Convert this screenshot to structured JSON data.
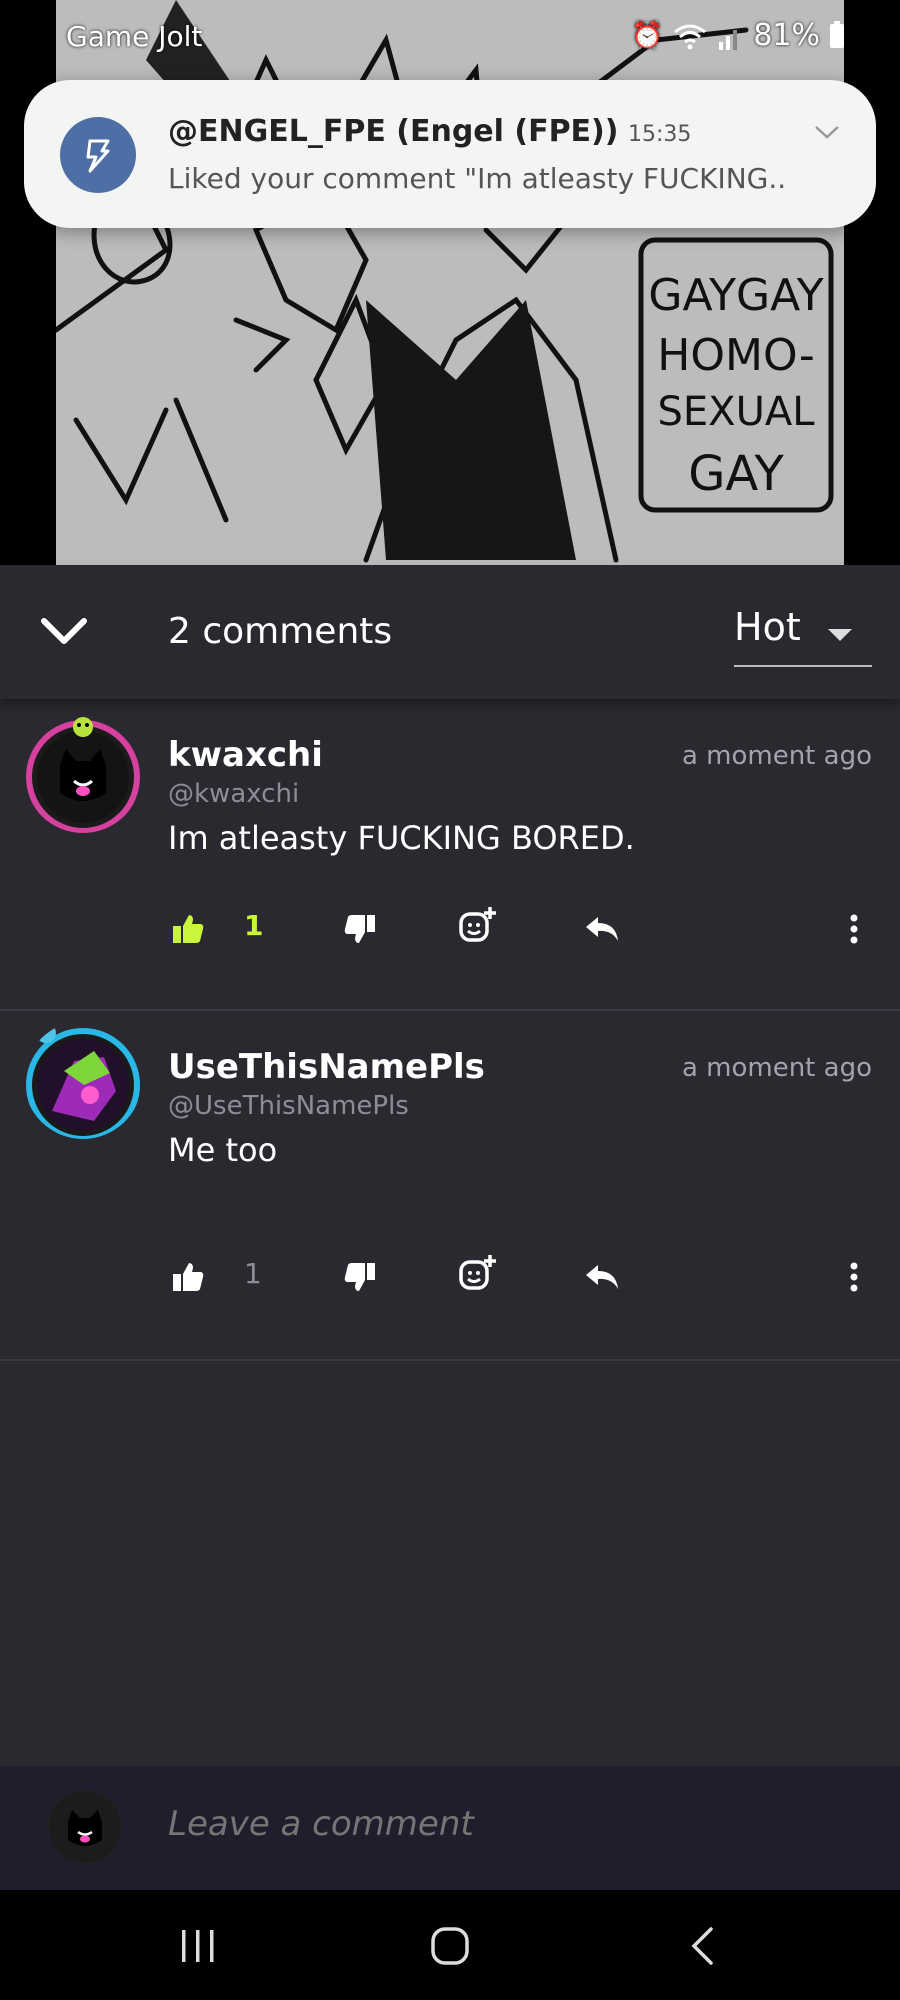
{
  "status_bar": {
    "app_name": "Game Jolt",
    "battery": "81%"
  },
  "notification": {
    "title": "@ENGEL_FPE (Engel (FPE))",
    "time": "15:35",
    "text": "Liked your comment \"Im atleasty FUCKING..",
    "accent": "#4d6fa6"
  },
  "hero": {
    "sign_lines": [
      "GAYGAY",
      "HOMO-",
      "SEXUAL",
      "GAY"
    ]
  },
  "comments_header": {
    "count_label": "2 comments",
    "sort_value": "Hot"
  },
  "comments": [
    {
      "author": "kwaxchi",
      "handle": "@kwaxchi",
      "time": "a moment ago",
      "text": "Im atleasty FUCKING BORED.",
      "likes": "1",
      "liked": true,
      "like_color": "#c9f53b"
    },
    {
      "author": "UseThisNamePls",
      "handle": "@UseThisNamePls",
      "time": "a moment ago",
      "text": "Me too",
      "likes": "1",
      "liked": false,
      "like_color": "#8e8d96"
    }
  ],
  "composer": {
    "placeholder": "Leave a comment"
  }
}
